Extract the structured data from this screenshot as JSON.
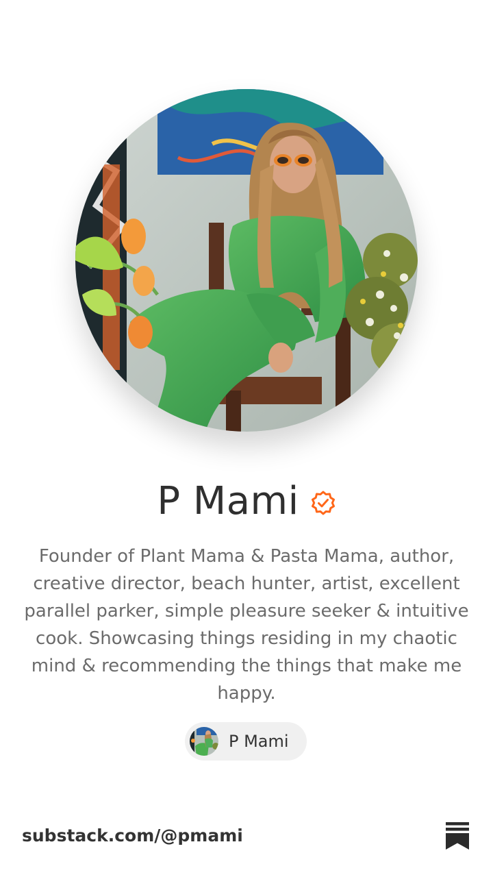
{
  "profile": {
    "name": "P Mami",
    "verified": true,
    "bio": "Founder of Plant Mama & Pasta Mama, author, creative director, beach hunter, artist, excellent parallel parker, simple pleasure seeker & intuitive cook. Showcasing things residing in my chaotic mind & recommending the things that make me happy.",
    "publication_chip": {
      "label": "P Mami"
    }
  },
  "footer": {
    "url": "substack.com/@pmami",
    "logo_icon": "substack-logo-icon"
  },
  "colors": {
    "accent": "#ff6719",
    "name_text": "#2f2f2f",
    "bio_text": "#6b6b6b",
    "chip_bg": "#f0f0f0"
  },
  "icons": {
    "verified": "verified-badge-icon"
  }
}
